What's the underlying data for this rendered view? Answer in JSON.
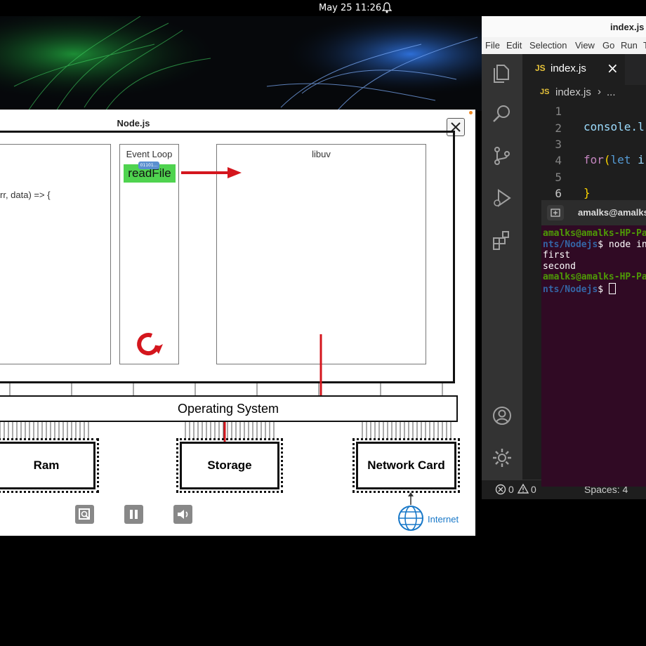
{
  "topbar": {
    "datetime": "May 25  11:26",
    "bell_icon": "bell-icon"
  },
  "video_window": {
    "title": "Node.js",
    "code_snippet": "rr, data) => {",
    "event_loop": {
      "title": "Event Loop",
      "function_label": "readFile",
      "bits_badge": "01101..."
    },
    "libuv": {
      "title": "libuv"
    },
    "os_label": "Operating System",
    "hardware": {
      "ram": "Ram",
      "storage": "Storage",
      "network": "Network Card"
    },
    "internet_label": "Internet",
    "controls": [
      "zoom-icon",
      "pause-icon",
      "volume-icon"
    ]
  },
  "vscode": {
    "window_title": "index.js -",
    "menu": [
      "File",
      "Edit",
      "Selection",
      "View",
      "Go",
      "Run",
      "T"
    ],
    "tab": {
      "icon": "JS",
      "label": "index.js",
      "close": "×"
    },
    "breadcrumb": {
      "icon": "JS",
      "file": "index.js",
      "sep": "›",
      "more": "..."
    },
    "line_numbers": [
      "1",
      "2",
      "3",
      "4",
      "5",
      "6"
    ],
    "code": {
      "line2_fn": "console.l",
      "line4_kw": "for",
      "line4_paren": "(",
      "line4_let": "let",
      "line4_var": "i",
      "line6": "}"
    },
    "status": {
      "errors": "0",
      "warnings": "0",
      "spaces": "Spaces: 4"
    }
  },
  "terminal": {
    "title": "amalks@amalks-",
    "lines": [
      {
        "user": "amalks@amalks-HP-Pav",
        "path": "",
        "cmd": ""
      },
      {
        "user": "",
        "path": "nts/Nodejs",
        "cmd": "$ node inc"
      },
      {
        "user": "",
        "path": "",
        "cmd": "first"
      },
      {
        "user": "",
        "path": "",
        "cmd": "second"
      },
      {
        "user": "amalks@amalks-HP-Pav",
        "path": "",
        "cmd": ""
      },
      {
        "user": "",
        "path": "nts/Nodejs",
        "cmd": "$ "
      }
    ]
  },
  "colors": {
    "node_green": "#4fd34f",
    "arrow_red": "#d4161d",
    "vscode_bg": "#1e1e1e",
    "terminal_bg": "#300a24"
  }
}
